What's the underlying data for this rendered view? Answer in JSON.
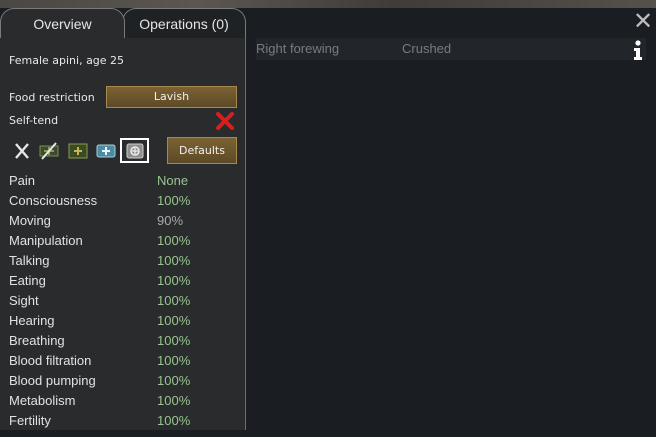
{
  "tabs": [
    {
      "label": "Overview"
    },
    {
      "label": "Operations (0)"
    }
  ],
  "pawn_description": "Female apini, age 25",
  "food_restriction": {
    "label": "Food restriction",
    "value": "Lavish"
  },
  "self_tend": {
    "label": "Self-tend",
    "enabled": false
  },
  "medicine_buttons": [
    {
      "icon": "no-care-icon"
    },
    {
      "icon": "no-meds-icon"
    },
    {
      "icon": "herbal-medicine-icon"
    },
    {
      "icon": "industrial-medicine-icon"
    },
    {
      "icon": "glitterworld-medicine-icon",
      "selected": true
    }
  ],
  "defaults_label": "Defaults",
  "capacities": [
    {
      "name": "Pain",
      "value": "None"
    },
    {
      "name": "Consciousness",
      "value": "100%"
    },
    {
      "name": "Moving",
      "value": "90%"
    },
    {
      "name": "Manipulation",
      "value": "100%"
    },
    {
      "name": "Talking",
      "value": "100%"
    },
    {
      "name": "Eating",
      "value": "100%"
    },
    {
      "name": "Sight",
      "value": "100%"
    },
    {
      "name": "Hearing",
      "value": "100%"
    },
    {
      "name": "Breathing",
      "value": "100%"
    },
    {
      "name": "Blood filtration",
      "value": "100%"
    },
    {
      "name": "Blood pumping",
      "value": "100%"
    },
    {
      "name": "Metabolism",
      "value": "100%"
    },
    {
      "name": "Fertility",
      "value": "100%"
    }
  ],
  "hediffs": [
    {
      "part": "Right forewing",
      "condition": "Crushed"
    }
  ],
  "colors": {
    "good": "#98c58f",
    "neutral": "#aaaaaa",
    "button": "#6b5530",
    "self_tend_off": "#d62020"
  }
}
